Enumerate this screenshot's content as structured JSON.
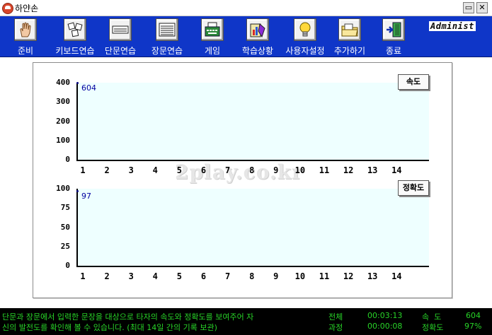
{
  "window": {
    "title": "하얀손",
    "minimize_glyph": "▭",
    "close_glyph": "✕"
  },
  "toolbar": {
    "items": [
      {
        "label": "준비",
        "icon": "hand-icon"
      },
      {
        "label": "키보드연습",
        "icon": "keyboard-keys-icon"
      },
      {
        "label": "단문연습",
        "icon": "short-lines-icon"
      },
      {
        "label": "장문연습",
        "icon": "long-lines-icon"
      },
      {
        "label": "게임",
        "icon": "typewriter-icon"
      },
      {
        "label": "학습상황",
        "icon": "statistics-icon"
      },
      {
        "label": "사용자설정",
        "icon": "lightbulb-icon"
      },
      {
        "label": "추가하기",
        "icon": "folder-icon"
      },
      {
        "label": "종료",
        "icon": "exit-door-icon"
      }
    ],
    "brand": "Administ"
  },
  "chart_data": [
    {
      "type": "line",
      "title": "속도",
      "x": [
        1,
        2,
        3,
        4,
        5,
        6,
        7,
        8,
        9,
        10,
        11,
        12,
        13,
        14
      ],
      "ylim": [
        0,
        400
      ],
      "yticks": [
        0,
        100,
        200,
        300,
        400
      ],
      "series": [
        {
          "values": [
            604
          ]
        }
      ],
      "data_labels": [
        "604"
      ],
      "grid": false,
      "legend_position": "top-right"
    },
    {
      "type": "line",
      "title": "정확도",
      "x": [
        1,
        2,
        3,
        4,
        5,
        6,
        7,
        8,
        9,
        10,
        11,
        12,
        13,
        14
      ],
      "ylim": [
        0,
        100
      ],
      "yticks": [
        0,
        25,
        50,
        75,
        100
      ],
      "series": [
        {
          "values": [
            97
          ]
        }
      ],
      "data_labels": [
        "97"
      ],
      "grid": false,
      "legend_position": "top-right"
    }
  ],
  "watermark": "2play.co.kr",
  "status": {
    "message_line1": "단문과 장문에서 입력한 문장을 대상으로 타자의 속도와 정확도를 보여주어 자",
    "message_line2": "신의 발전도를 확인해 볼 수 있습니다. (최대 14일 간의 기록 보관)",
    "total_label": "전체",
    "total_time": "00:03:13",
    "course_label": "과정",
    "course_time": "00:00:08",
    "speed_label": "속  도",
    "speed_value": "604",
    "accuracy_label": "정확도",
    "accuracy_value": "97%"
  },
  "colors": {
    "toolbar": "#0f36c8",
    "plot_bg": "#eeffff",
    "status_text": "#28d428",
    "data_label": "#0000a0"
  }
}
